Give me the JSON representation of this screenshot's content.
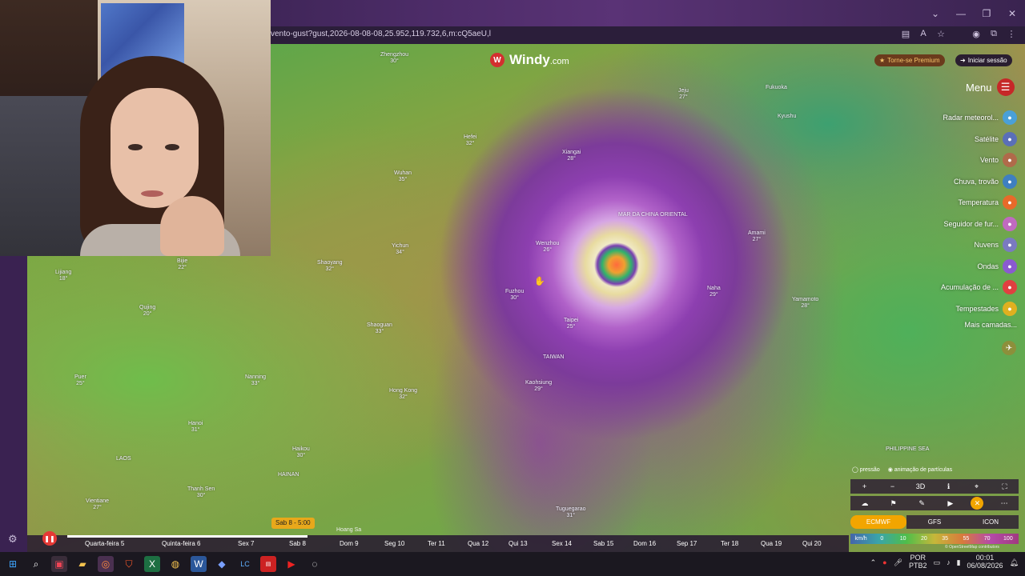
{
  "browser": {
    "url": "vento-gust?gust,2026-08-08-08,25.952,119.732,6,m:cQ5aeU,l",
    "window_controls": [
      "minimize",
      "maximize",
      "close"
    ]
  },
  "app": {
    "logo_text": "Windy",
    "logo_suffix": ".com",
    "premium_label": "Torne-se Premium",
    "login_label": "Iniciar sessão",
    "menu_label": "Menu"
  },
  "layers": [
    {
      "label": "Radar meteorol...",
      "color": "#4aa0d8",
      "icon": "radar-icon"
    },
    {
      "label": "Satélite",
      "color": "#5a6fb8",
      "icon": "satellite-icon"
    },
    {
      "label": "Vento",
      "color": "#b06a4a",
      "icon": "wind-icon"
    },
    {
      "label": "Chuva, trovão",
      "color": "#3f7fc0",
      "icon": "rain-icon"
    },
    {
      "label": "Temperatura",
      "color": "#e86a2a",
      "icon": "temperature-icon"
    },
    {
      "label": "Seguidor de fur...",
      "color": "#c06ac0",
      "icon": "hurricane-icon"
    },
    {
      "label": "Nuvens",
      "color": "#7a7ac0",
      "icon": "cloud-icon"
    },
    {
      "label": "Ondas",
      "color": "#8a5ad0",
      "icon": "waves-icon"
    },
    {
      "label": "Acumulação de ...",
      "color": "#e04040",
      "icon": "accumulation-icon"
    },
    {
      "label": "Tempestades",
      "color": "#e0b020",
      "icon": "storm-icon"
    }
  ],
  "more_layers_label": "Mais camadas...",
  "map_options": {
    "pressure_label": "pressão",
    "particles_label": "animação de partículas"
  },
  "controls": {
    "zoom_in": "+",
    "zoom_out": "−",
    "mode_3d": "3D"
  },
  "models": [
    {
      "label": "ECMWF",
      "active": true
    },
    {
      "label": "GFS",
      "active": false
    },
    {
      "label": "ICON",
      "active": false
    }
  ],
  "scale": {
    "unit": "km/h",
    "values": [
      "0",
      "10",
      "20",
      "35",
      "55",
      "70",
      "100"
    ]
  },
  "attribution": "© OpenStreetMap contributors",
  "timeline": {
    "current_time": "Sab 8 - 5:00",
    "days": [
      "Quarta-feira 5",
      "Quinta-feira 6",
      "Sex 7",
      "Sab 8",
      "Dom 9",
      "Seg 10",
      "Ter 11",
      "Qua 12",
      "Qui 13",
      "Sex 14",
      "Sab 15",
      "Dom 16",
      "Sep 17",
      "Ter 18",
      "Qua 19",
      "Qui 20"
    ]
  },
  "map_labels": [
    {
      "name": "Zhengzhou",
      "value": "30°"
    },
    {
      "name": "Hefei",
      "value": "32°"
    },
    {
      "name": "Wuhan",
      "value": "35°"
    },
    {
      "name": "Xiangai",
      "value": "28°"
    },
    {
      "name": "Jeju",
      "value": "27°"
    },
    {
      "name": "Fukuoka",
      "value": ""
    },
    {
      "name": "Kyushu",
      "value": ""
    },
    {
      "name": "MAR DA CHINA ORIENTAL",
      "value": ""
    },
    {
      "name": "Wenzhou",
      "value": "26°"
    },
    {
      "name": "Yichun",
      "value": "34°"
    },
    {
      "name": "Shaoyang",
      "value": "32°"
    },
    {
      "name": "Lijiang",
      "value": "18°"
    },
    {
      "name": "Bijie",
      "value": "22°"
    },
    {
      "name": "Qujing",
      "value": "20°"
    },
    {
      "name": "Fuzhou",
      "value": "30°"
    },
    {
      "name": "Amami",
      "value": "27°"
    },
    {
      "name": "Naha",
      "value": "29°"
    },
    {
      "name": "Yamamoto",
      "value": "28°"
    },
    {
      "name": "Taipei",
      "value": "25°"
    },
    {
      "name": "Shaoguan",
      "value": "33°"
    },
    {
      "name": "TAIWAN",
      "value": ""
    },
    {
      "name": "Kaohsiung",
      "value": "29°"
    },
    {
      "name": "Hong Kong",
      "value": "32°"
    },
    {
      "name": "Nanning",
      "value": "33°"
    },
    {
      "name": "Puer",
      "value": "25°"
    },
    {
      "name": "Hanoi",
      "value": "31°"
    },
    {
      "name": "Haikou",
      "value": "30°"
    },
    {
      "name": "HAINAN",
      "value": ""
    },
    {
      "name": "LAOS",
      "value": ""
    },
    {
      "name": "Thanh Sen",
      "value": "30°"
    },
    {
      "name": "Vientiane",
      "value": "27°"
    },
    {
      "name": "Tuguegarao",
      "value": "31°"
    },
    {
      "name": "PHILIPPINE SEA",
      "value": ""
    }
  ],
  "bottom_place": "Hoang Sa",
  "taskbar": {
    "language_1": "POR",
    "language_2": "PTB2",
    "time": "00:01",
    "date": "06/08/2026"
  }
}
